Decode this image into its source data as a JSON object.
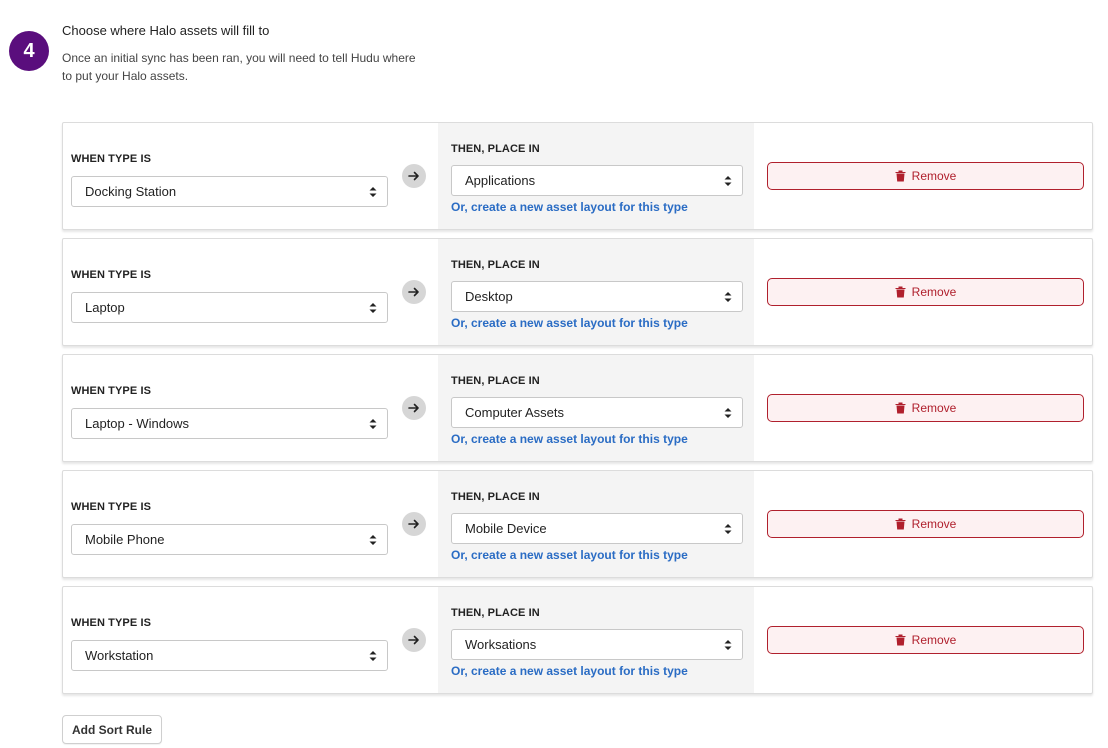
{
  "step": {
    "number": "4",
    "title": "Choose where Halo assets will fill to",
    "description": "Once an initial sync has been ran, you will need to tell Hudu where to put your Halo assets."
  },
  "labels": {
    "when": "WHEN TYPE IS",
    "then": "THEN, PLACE IN",
    "create_link": "Or, create a new asset layout for this type",
    "remove": "Remove",
    "add_rule": "Add Sort Rule"
  },
  "rules": [
    {
      "when_type": "Docking Station",
      "place_in": "Applications"
    },
    {
      "when_type": "Laptop",
      "place_in": "Desktop"
    },
    {
      "when_type": "Laptop - Windows",
      "place_in": "Computer Assets"
    },
    {
      "when_type": "Mobile Phone",
      "place_in": "Mobile Device"
    },
    {
      "when_type": "Workstation",
      "place_in": "Worksations"
    }
  ],
  "icons": {
    "arrow": "arrow-right-icon",
    "trash": "trash-icon",
    "select": "chevron-up-down-icon"
  },
  "colors": {
    "badge": "#5a0e7d",
    "link": "#2a6cc4",
    "danger": "#b0202d"
  }
}
